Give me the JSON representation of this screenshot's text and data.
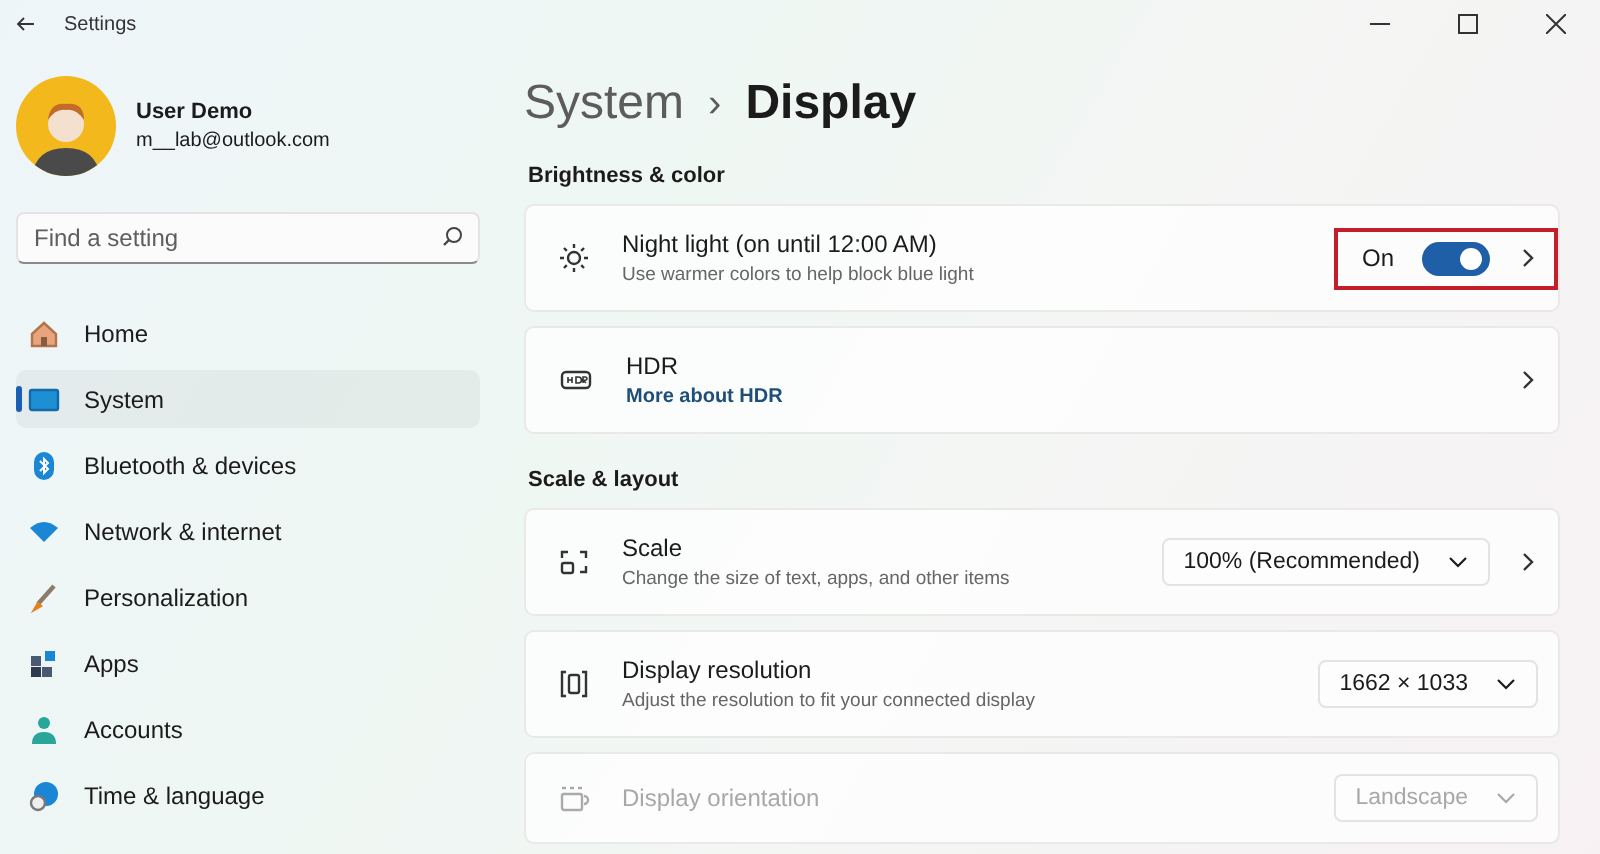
{
  "window": {
    "title": "Settings"
  },
  "profile": {
    "name": "User Demo",
    "email": "m__lab@outlook.com"
  },
  "search": {
    "placeholder": "Find a setting"
  },
  "nav": [
    {
      "label": "Home",
      "selected": false
    },
    {
      "label": "System",
      "selected": true
    },
    {
      "label": "Bluetooth & devices",
      "selected": false
    },
    {
      "label": "Network & internet",
      "selected": false
    },
    {
      "label": "Personalization",
      "selected": false
    },
    {
      "label": "Apps",
      "selected": false
    },
    {
      "label": "Accounts",
      "selected": false
    },
    {
      "label": "Time & language",
      "selected": false
    }
  ],
  "breadcrumb": {
    "parent": "System",
    "separator": "›",
    "current": "Display"
  },
  "sections": [
    {
      "title": "Brightness & color",
      "rows": [
        {
          "kind": "toggle",
          "title": "Night light (on until 12:00 AM)",
          "subtitle": "Use warmer colors to help block blue light",
          "state_label": "On",
          "on": true,
          "highlighted": true,
          "disabled": false
        },
        {
          "kind": "link",
          "title": "HDR",
          "link": "More about HDR",
          "highlighted": false,
          "disabled": false
        }
      ]
    },
    {
      "title": "Scale & layout",
      "rows": [
        {
          "kind": "dropdown-link",
          "title": "Scale",
          "subtitle": "Change the size of text, apps, and other items",
          "value": "100% (Recommended)",
          "highlighted": false,
          "disabled": false
        },
        {
          "kind": "dropdown",
          "title": "Display resolution",
          "subtitle": "Adjust the resolution to fit your connected display",
          "value": "1662 × 1033",
          "highlighted": false,
          "disabled": false
        },
        {
          "kind": "dropdown",
          "title": "Display orientation",
          "value": "Landscape",
          "highlighted": false,
          "disabled": true
        }
      ]
    }
  ]
}
